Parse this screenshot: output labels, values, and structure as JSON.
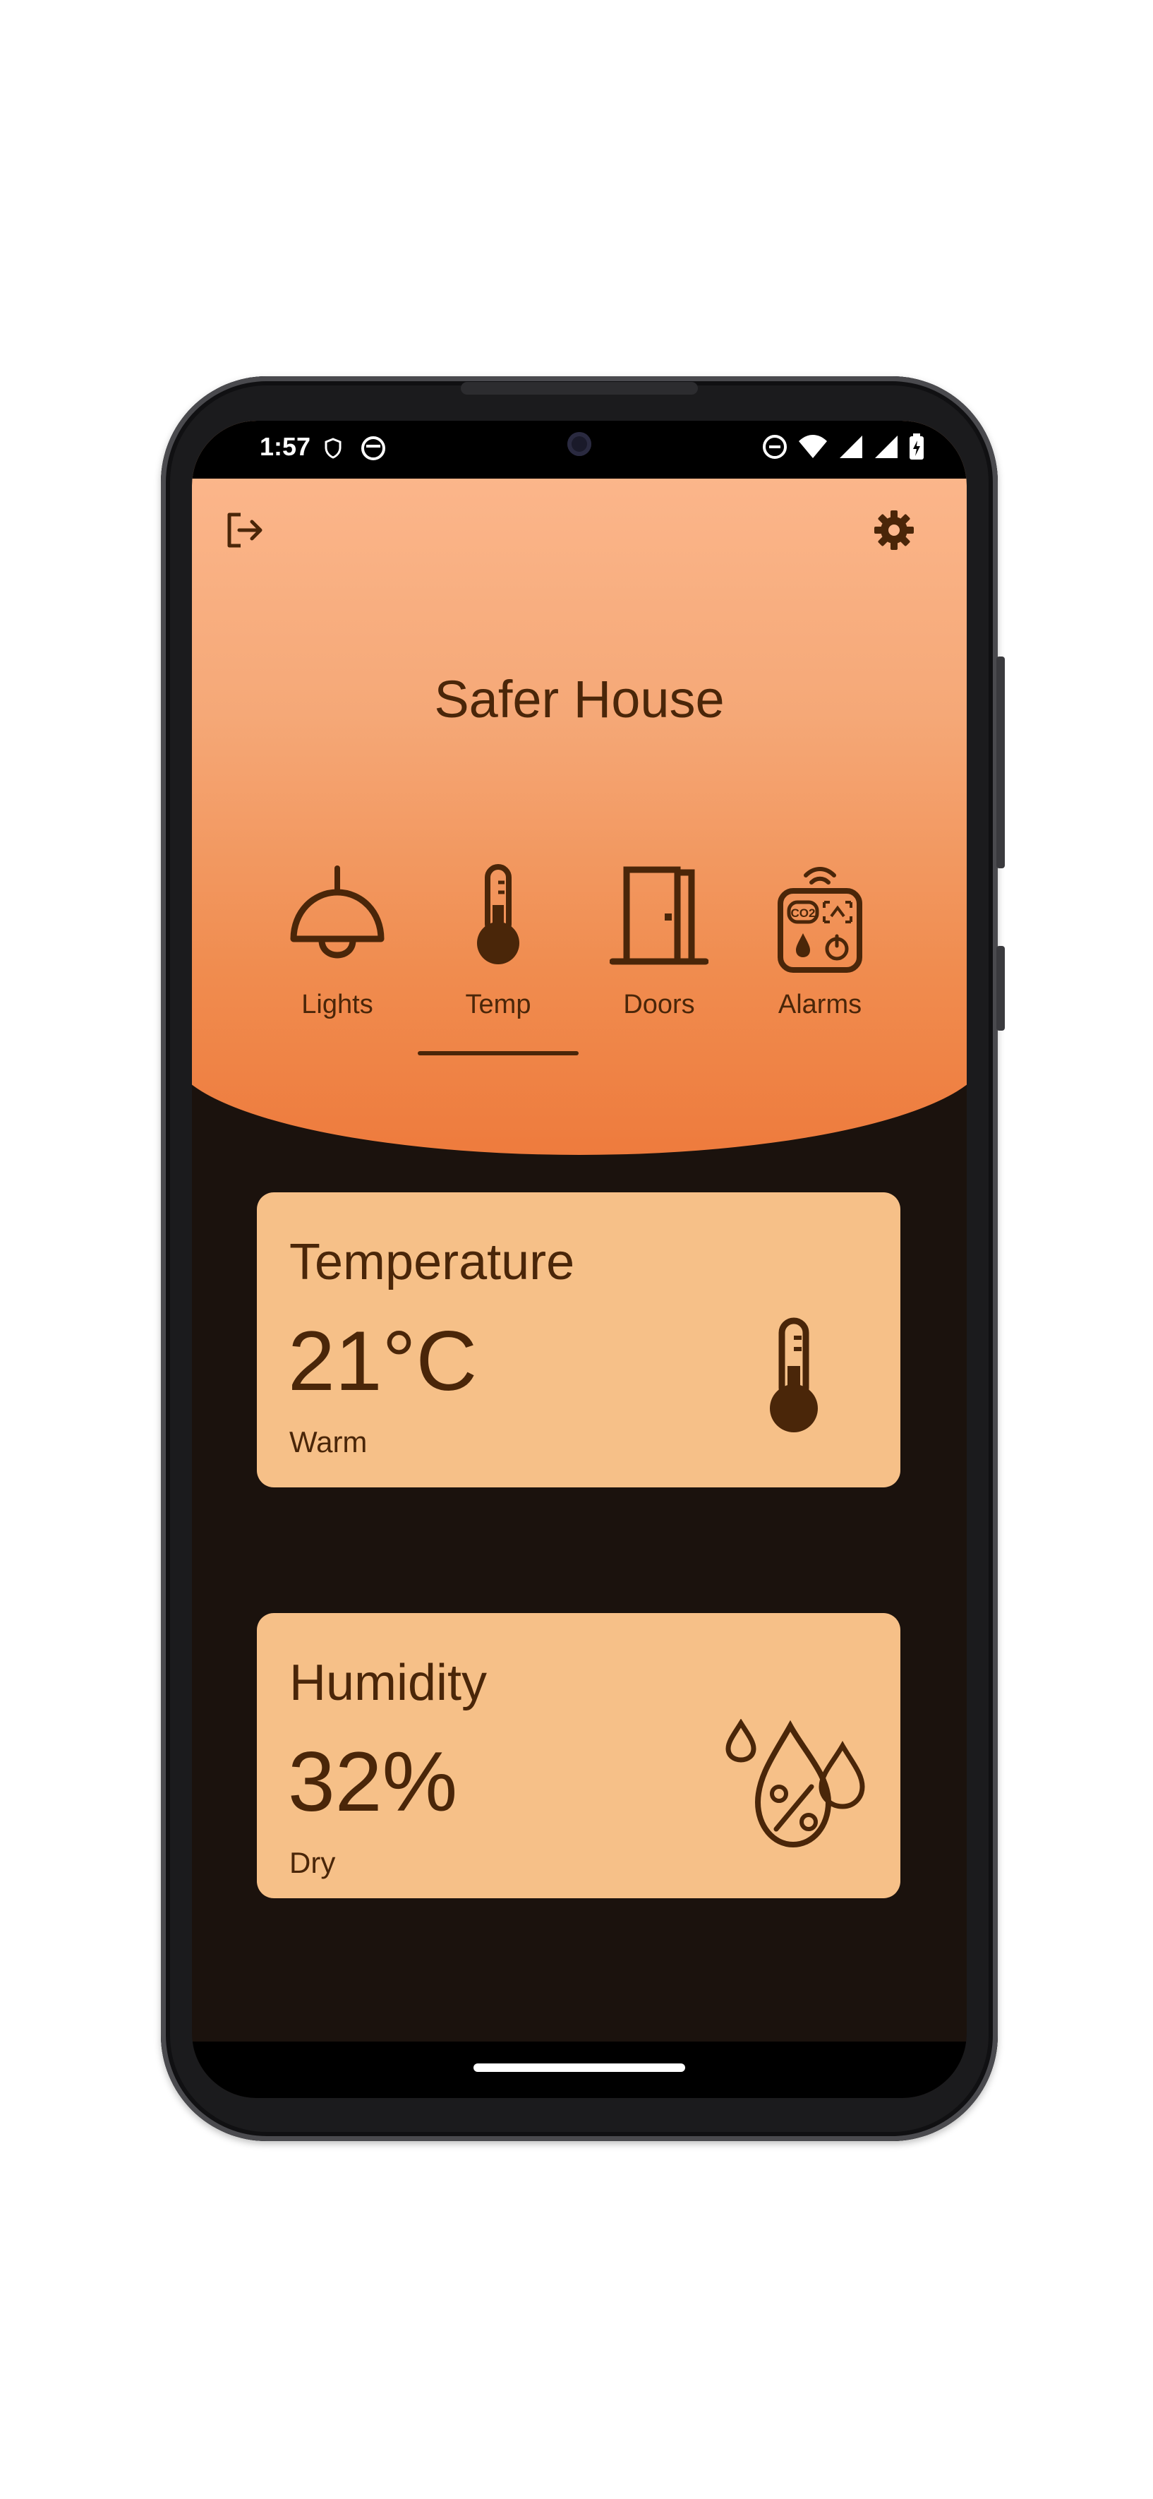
{
  "status_bar": {
    "time": "1:57",
    "icons": [
      "shield-icon",
      "notification-icon",
      "do-not-disturb-icon",
      "wifi-icon",
      "signal-icon",
      "signal-icon",
      "battery-icon"
    ]
  },
  "app": {
    "title": "Safer House",
    "logout_icon": "logout-icon",
    "settings_icon": "gear-icon",
    "colors": {
      "primary_text": "#4a2609",
      "header_top": "#fdb98f",
      "header_bottom": "#ee7b3d",
      "background": "#1b120d",
      "card": "#f6c088"
    }
  },
  "tabs": [
    {
      "label": "Lights",
      "icon": "lamp-icon",
      "selected": false
    },
    {
      "label": "Temp",
      "icon": "thermometer-icon",
      "selected": true
    },
    {
      "label": "Doors",
      "icon": "door-icon",
      "selected": false
    },
    {
      "label": "Alarms",
      "icon": "alarm-sensor-icon",
      "selected": false
    }
  ],
  "cards": [
    {
      "title": "Temperature",
      "value": "21°C",
      "status": "Warm",
      "icon": "thermometer-icon"
    },
    {
      "title": "Humidity",
      "value": "32%",
      "status": "Dry",
      "icon": "humidity-icon"
    }
  ]
}
